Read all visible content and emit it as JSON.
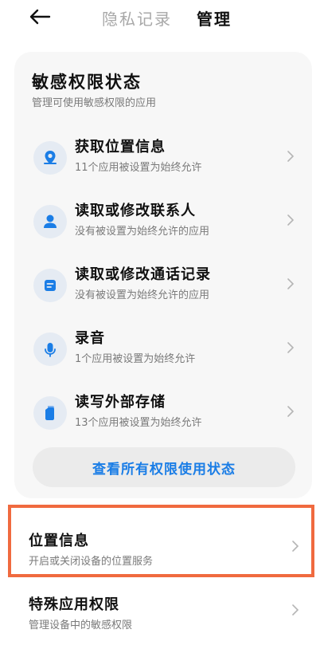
{
  "header": {
    "tabs": [
      {
        "label": "隐私记录",
        "active": false
      },
      {
        "label": "管理",
        "active": true
      }
    ],
    "back_icon": "arrow-left-icon"
  },
  "card": {
    "title": "敏感权限状态",
    "subtitle": "管理可使用敏感权限的应用",
    "items": [
      {
        "title": "获取位置信息",
        "desc": "11个应用被设置为始终允许",
        "icon": "location-pin-icon"
      },
      {
        "title": "读取或修改联系人",
        "desc": "没有被设置为始终允许的应用",
        "icon": "person-icon"
      },
      {
        "title": "读取或修改通话记录",
        "desc": "没有被设置为始终允许的应用",
        "icon": "call-log-icon"
      },
      {
        "title": "录音",
        "desc": "1个应用被设置为始终允许",
        "icon": "microphone-icon"
      },
      {
        "title": "读写外部存储",
        "desc": "13个应用被设置为始终允许",
        "icon": "storage-icon"
      }
    ],
    "view_all_label": "查看所有权限使用状态"
  },
  "rows": [
    {
      "title": "位置信息",
      "desc": "开启或关闭设备的位置服务"
    },
    {
      "title": "特殊应用权限",
      "desc": "管理设备中的敏感权限"
    }
  ],
  "colors": {
    "accent": "#1a7de6",
    "highlight": "#f06a3f",
    "icon_bg": "#e5ebf3"
  }
}
